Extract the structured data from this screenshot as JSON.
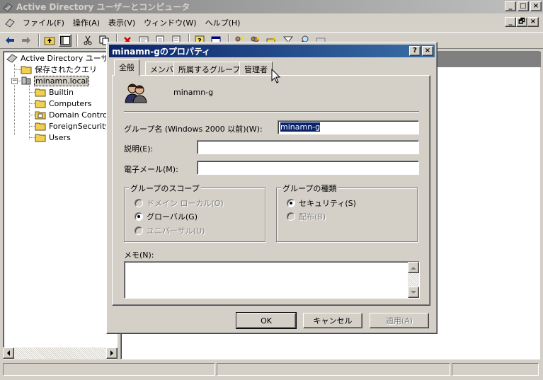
{
  "main_window": {
    "title": "Active Directory ユーザーとコンピュータ",
    "title_buttons": [
      "_",
      "□",
      "×"
    ]
  },
  "menubar": {
    "items": [
      "ファイル(F)",
      "操作(A)",
      "表示(V)",
      "ウィンドウ(W)",
      "ヘルプ(H)"
    ],
    "mdi_buttons": [
      "_",
      "🗗",
      "×"
    ]
  },
  "toolbar": {
    "icons": [
      "back-arrow",
      "forward-arrow",
      "up-folder",
      "show-hide-tree",
      "cut",
      "copy",
      "delete",
      "properties",
      "refresh",
      "export-list",
      "help",
      "console",
      "new-user",
      "new-group",
      "new-ou",
      "filter",
      "find",
      "add-to-group"
    ]
  },
  "tree": {
    "root_label": "Active Directory ユーザー",
    "saved_queries": "保存されたクエリ",
    "domain": "minamn.local",
    "children": [
      "Builtin",
      "Computers",
      "Domain Controll",
      "ForeignSecurityI",
      "Users"
    ]
  },
  "dialog": {
    "title": "minamn-gのプロパティ",
    "title_buttons": [
      "?",
      "×"
    ],
    "tabs": [
      "全般",
      "メンバ",
      "所属するグループ",
      "管理者"
    ],
    "active_tab": "全般",
    "group_display_name": "minamn-g",
    "fields": {
      "pre2000_label": "グループ名 (Windows 2000 以前)(W):",
      "pre2000_value": "minamn-g",
      "description_label": "説明(E):",
      "description_value": "",
      "email_label": "電子メール(M):",
      "email_value": "",
      "notes_label": "メモ(N):",
      "notes_value": ""
    },
    "scope": {
      "title": "グループのスコープ",
      "options": [
        {
          "label": "ドメイン ローカル(O)",
          "checked": false,
          "enabled": false
        },
        {
          "label": "グローバル(G)",
          "checked": true,
          "enabled": true
        },
        {
          "label": "ユニバーサル(U)",
          "checked": false,
          "enabled": false
        }
      ]
    },
    "type": {
      "title": "グループの種類",
      "options": [
        {
          "label": "セキュリティ(S)",
          "checked": true,
          "enabled": true
        },
        {
          "label": "配布(B)",
          "checked": false,
          "enabled": false
        }
      ]
    },
    "buttons": {
      "ok": "OK",
      "cancel": "キャンセル",
      "apply": "適用(A)"
    }
  },
  "colors": {
    "face": "#d4d0c8",
    "active_title_start": "#0a246a",
    "active_title_end": "#3a6ea5",
    "inactive_title_start": "#808080",
    "inactive_title_end": "#c0c0c0",
    "selection": "#0a246a"
  }
}
